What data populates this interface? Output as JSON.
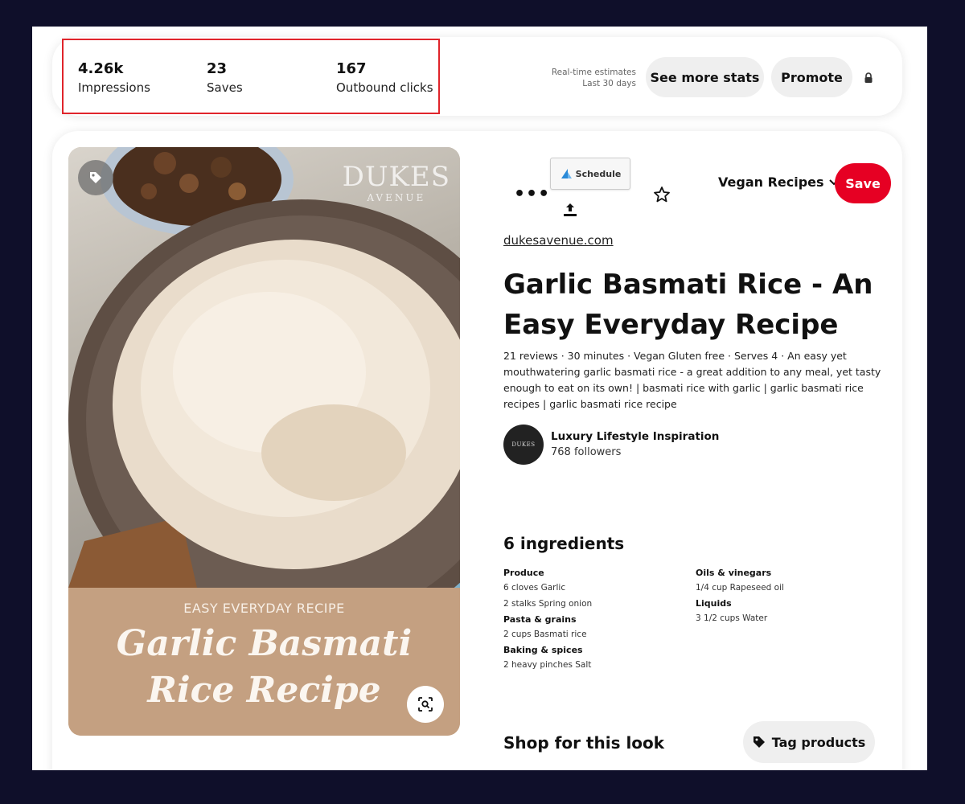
{
  "stats": {
    "impressions_value": "4.26k",
    "impressions_label": "Impressions",
    "saves_value": "23",
    "saves_label": "Saves",
    "clicks_value": "167",
    "clicks_label": "Outbound clicks",
    "estimate_line1": "Real-time estimates",
    "estimate_line2": "Last 30 days",
    "see_more_label": "See more stats",
    "promote_label": "Promote"
  },
  "pin_image": {
    "watermark_line1": "DUKES",
    "watermark_line2": "AVENUE",
    "kicker": "EASY EVERYDAY RECIPE",
    "headline_line1": "Garlic Basmati",
    "headline_line2": "Rice Recipe"
  },
  "toolbar": {
    "more": "•••",
    "schedule_label": "Schedule",
    "board_name": "Vegan Recipes",
    "save_label": "Save"
  },
  "pin": {
    "domain": "dukesavenue.com",
    "title": "Garlic Basmati Rice - An Easy Everyday Recipe",
    "description": "21 reviews · 30 minutes · Vegan Gluten free · Serves 4 · An easy yet mouthwatering garlic basmati rice - a great addition to any meal, yet tasty enough to eat on its own! | basmati rice with garlic | garlic basmati rice recipes | garlic basmati rice recipe"
  },
  "creator": {
    "avatar_text": "DUKES",
    "name": "Luxury Lifestyle Inspiration",
    "followers": "768 followers"
  },
  "ingredients": {
    "title": "6 ingredients",
    "left": [
      {
        "group": "Produce",
        "items": [
          "6 cloves Garlic",
          "2 stalks Spring onion"
        ]
      },
      {
        "group": "Pasta & grains",
        "items": [
          "2 cups Basmati rice"
        ]
      },
      {
        "group": "Baking & spices",
        "items": [
          "2 heavy pinches Salt"
        ]
      }
    ],
    "right": [
      {
        "group": "Oils & vinegars",
        "items": [
          "1/4 cup Rapeseed oil"
        ]
      },
      {
        "group": "Liquids",
        "items": [
          "3 1/2 cups Water"
        ]
      }
    ]
  },
  "shop": {
    "title": "Shop for this look",
    "tag_products_label": "Tag products"
  },
  "colors": {
    "save_red": "#e60023",
    "highlight_red": "#e0242b",
    "page_bg": "#0f0f2a"
  }
}
